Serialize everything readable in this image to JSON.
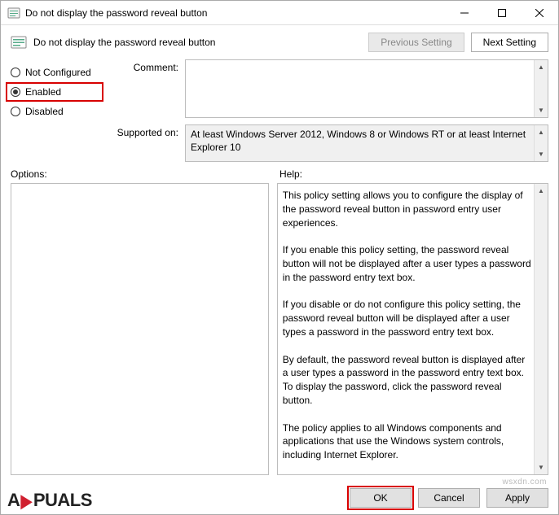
{
  "window": {
    "title": "Do not display the password reveal button"
  },
  "header": {
    "title": "Do not display the password reveal button",
    "prev_label": "Previous Setting",
    "next_label": "Next Setting"
  },
  "state": {
    "not_configured_label": "Not Configured",
    "enabled_label": "Enabled",
    "disabled_label": "Disabled",
    "selected": "enabled"
  },
  "fields": {
    "comment_label": "Comment:",
    "comment_value": "",
    "supported_label": "Supported on:",
    "supported_value": "At least Windows Server 2012, Windows 8 or Windows RT or at least Internet Explorer 10"
  },
  "labels": {
    "options": "Options:",
    "help": "Help:"
  },
  "help_text": "This policy setting allows you to configure the display of the password reveal button in password entry user experiences.\n\nIf you enable this policy setting, the password reveal button will not be displayed after a user types a password in the password entry text box.\n\nIf you disable or do not configure this policy setting, the password reveal button will be displayed after a user types a password in the password entry text box.\n\nBy default, the password reveal button is displayed after a user types a password in the password entry text box. To display the password, click the password reveal button.\n\nThe policy applies to all Windows components and applications that use the Windows system controls, including Internet Explorer.",
  "footer": {
    "ok": "OK",
    "cancel": "Cancel",
    "apply": "Apply"
  },
  "watermark": {
    "right": "wsxdn.com"
  }
}
